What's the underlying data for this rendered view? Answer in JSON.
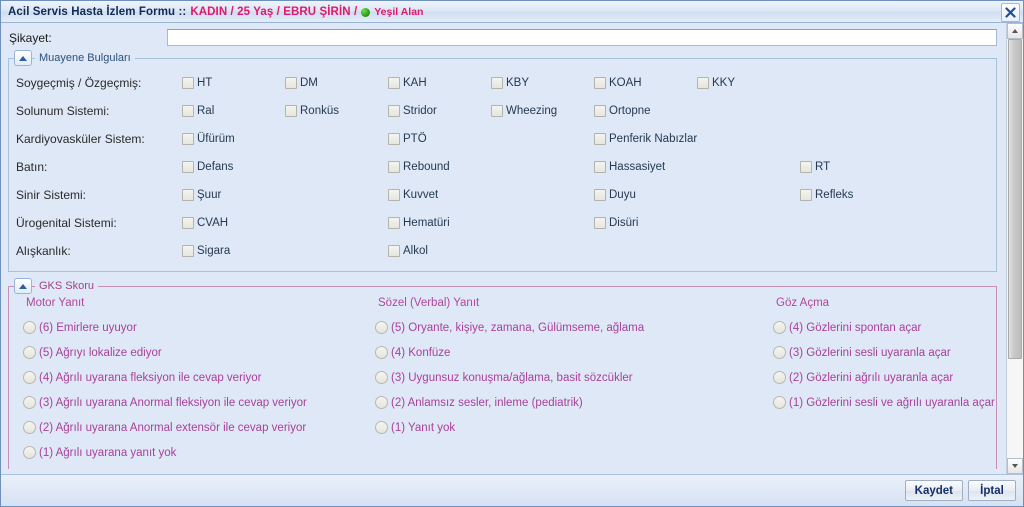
{
  "titlebar": {
    "form_title": "Acil Servis Hasta İzlem Formu ::",
    "patient_info": "KADIN / 25 Yaş / EBRU ŞİRİN /",
    "triage_area": "Yeşil Alan",
    "triage_color": "#2c9d16",
    "accent_pink": "#e0186e",
    "close_label": "X"
  },
  "complaint": {
    "label": "Şikayet:",
    "value": "",
    "placeholder": ""
  },
  "exam_group": {
    "title": "Muayene Bulguları",
    "rows": [
      {
        "label": "Soygeçmiş / Özgeçmiş:",
        "layout": "even",
        "items": [
          {
            "label": "HT",
            "checked": false
          },
          {
            "label": "DM",
            "checked": false
          },
          {
            "label": "KAH",
            "checked": false
          },
          {
            "label": "KBY",
            "checked": false
          },
          {
            "label": "KOAH",
            "checked": false
          },
          {
            "label": "KKY",
            "checked": false
          }
        ]
      },
      {
        "label": "Solunum Sistemi:",
        "layout": "even",
        "items": [
          {
            "label": "Ral",
            "checked": false
          },
          {
            "label": "Ronküs",
            "checked": false
          },
          {
            "label": "Stridor",
            "checked": false
          },
          {
            "label": "Wheezing",
            "checked": false
          },
          {
            "label": "Ortopne",
            "checked": false
          }
        ]
      },
      {
        "label": "Kardiyovasküler Sistem:",
        "layout": "wide",
        "items": [
          {
            "label": "Üfürüm",
            "checked": false
          },
          {
            "label": "PTÖ",
            "checked": false
          },
          {
            "label": "Penferik Nabızlar",
            "checked": false
          }
        ]
      },
      {
        "label": "Batın:",
        "layout": "wide",
        "items": [
          {
            "label": "Defans",
            "checked": false
          },
          {
            "label": "Rebound",
            "checked": false
          },
          {
            "label": "Hassasiyet",
            "checked": false
          },
          {
            "label": "RT",
            "checked": false
          }
        ]
      },
      {
        "label": "Sinir Sistemi:",
        "layout": "wide",
        "items": [
          {
            "label": "Şuur",
            "checked": false
          },
          {
            "label": "Kuvvet",
            "checked": false
          },
          {
            "label": "Duyu",
            "checked": false
          },
          {
            "label": "Refleks",
            "checked": false
          }
        ]
      },
      {
        "label": "Ürogenital Sistemi:",
        "layout": "wide",
        "items": [
          {
            "label": "CVAH",
            "checked": false
          },
          {
            "label": "Hematüri",
            "checked": false
          },
          {
            "label": "Disüri",
            "checked": false
          }
        ]
      },
      {
        "label": "Alışkanlık:",
        "layout": "wide",
        "items": [
          {
            "label": "Sigara",
            "checked": false
          },
          {
            "label": "Alkol",
            "checked": false
          }
        ]
      }
    ]
  },
  "gks_group": {
    "title": "GKS Skoru",
    "columns": [
      {
        "title": "Motor Yanıt",
        "options": [
          {
            "label": "(6) Emirlere uyuyor",
            "selected": false
          },
          {
            "label": "(5) Ağrıyı lokalize ediyor",
            "selected": false
          },
          {
            "label": "(4) Ağrılı uyarana fleksiyon ile cevap veriyor",
            "selected": false
          },
          {
            "label": "(3) Ağrılı uyarana Anormal fleksiyon ile cevap veriyor",
            "selected": false
          },
          {
            "label": "(2) Ağrılı uyarana Anormal extensör ile cevap veriyor",
            "selected": false
          },
          {
            "label": "(1) Ağrılı uyarana yanıt yok",
            "selected": false
          }
        ]
      },
      {
        "title": "Sözel (Verbal) Yanıt",
        "options": [
          {
            "label": "(5) Oryante, kişiye, zamana, Gülümseme, ağlama",
            "selected": false
          },
          {
            "label": "(4) Konfüze",
            "selected": false
          },
          {
            "label": "(3) Uygunsuz konuşma/ağlama, basit sözcükler",
            "selected": false
          },
          {
            "label": "(2) Anlamsız sesler, inleme (pediatrik)",
            "selected": false
          },
          {
            "label": "(1) Yanıt yok",
            "selected": false
          }
        ]
      },
      {
        "title": "Göz Açma",
        "options": [
          {
            "label": "(4) Gözlerini spontan açar",
            "selected": false
          },
          {
            "label": "(3) Gözlerini sesli uyaranla açar",
            "selected": false
          },
          {
            "label": "(2) Gözlerini ağrılı uyaranla açar",
            "selected": false
          },
          {
            "label": "(1) Gözlerini sesli ve ağrılı uyaranla açar",
            "selected": false
          }
        ]
      }
    ]
  },
  "footer": {
    "save_label": "Kaydet",
    "cancel_label": "İptal"
  },
  "scrollbar": {
    "up_arrow": "▲",
    "down_arrow": "▼",
    "thumb_position_percent": 0
  }
}
